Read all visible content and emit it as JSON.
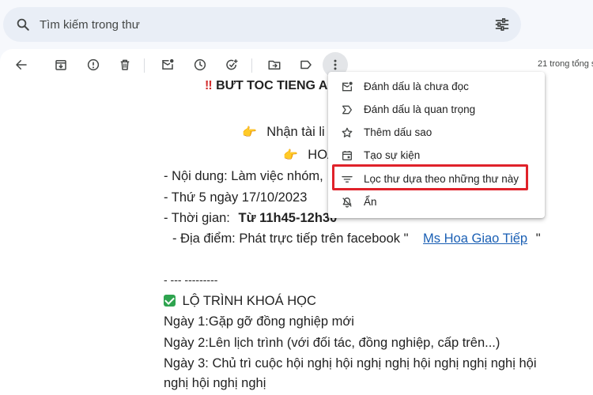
{
  "search": {
    "placeholder": "Tìm kiếm trong thư"
  },
  "toolbar": {
    "count": "21 trong tổng s"
  },
  "email": {
    "title": "BƯT TOC TIENG A",
    "line_receive": "Nhận tài li",
    "line_hoa": "HOA",
    "line_content": "- Nội dung: Làm việc nhóm,",
    "line_date": "-  Thứ 5 ngày 17/10/2023",
    "line_time_label": "- Thời gian:",
    "line_time_value": "Từ 11h45-12h30",
    "line_place": "- Địa điểm: Phát trực tiếp trên facebook \"",
    "line_place_link": "Ms Hoa Giao Tiếp",
    "line_place_end": "\"",
    "line_dashes": "- --- ---------",
    "line_roadmap": "LỘ TRÌNH KHOÁ HỌC",
    "line_day1": "Ngày 1:Gặp gỡ đồng nghiệp mới",
    "line_day2": "Ngày 2:Lên lịch trình (với đối tác, đồng nghiệp, cấp trên...)",
    "line_day3": "Ngày 3: Chủ trì cuộc hội nghị hội nghị nghị hội nghị nghị nghị hội",
    "line_day3b": "nghị hội nghị nghị"
  },
  "menu": {
    "items": [
      {
        "label": "Đánh dấu là chưa đọc",
        "icon": "mark-unread-icon"
      },
      {
        "label": "Đánh dấu là quan trọng",
        "icon": "important-icon"
      },
      {
        "label": "Thêm dấu sao",
        "icon": "star-icon"
      },
      {
        "label": "Tạo sự kiện",
        "icon": "calendar-icon"
      },
      {
        "label": "Lọc thư dựa theo những thư này",
        "icon": "filter-icon"
      },
      {
        "label": "Ẩn",
        "icon": "mute-icon"
      }
    ],
    "highlight_color": "#e0222a"
  }
}
